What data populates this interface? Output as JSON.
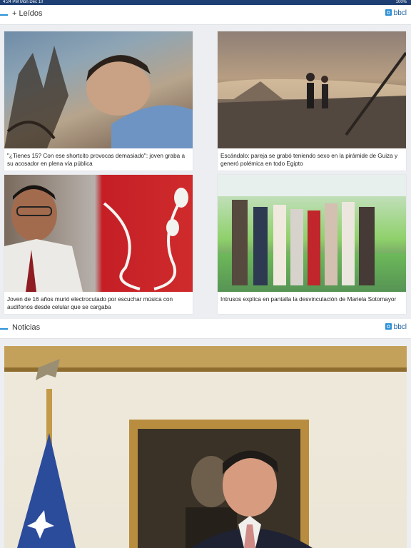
{
  "status_bar": {
    "left": "4:24 PM   Mon Dec 10",
    "right": "100%"
  },
  "sections": [
    {
      "title": "+ Leídos",
      "brand": "bbcl"
    },
    {
      "title": "Noticias",
      "brand": "bbcl"
    }
  ],
  "articles": [
    {
      "caption": "\"¿Tienes 15? Con ese shortcito provocas demasiado\": joven graba a su acosador en plena vía pública"
    },
    {
      "caption": "Escándalo: pareja se grabó teniendo sexo en la pirámide de Guiza y generó polémica en todo Egipto"
    },
    {
      "caption": "Joven de 16 años murió electrocutado por escuchar música con audífonos desde celular que se cargaba"
    },
    {
      "caption": "Intrusos explica en pantalla la desvinculación de Mariela Sotomayor"
    }
  ],
  "colors": {
    "accent": "#2a8fd6",
    "status_bar": "#1d3f73",
    "background": "#eceef1",
    "brand": "#1a5fa0"
  }
}
